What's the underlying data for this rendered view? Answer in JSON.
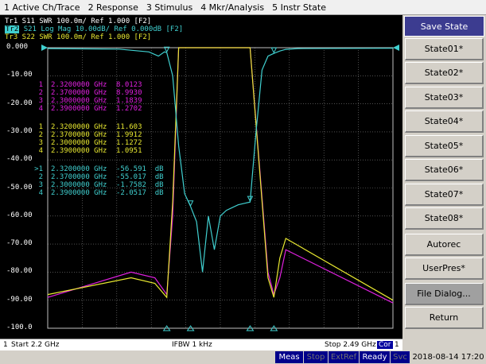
{
  "menu": [
    "1 Active Ch/Trace",
    "2 Response",
    "3 Stimulus",
    "4 Mkr/Analysis",
    "5 Instr State"
  ],
  "traces": {
    "tr1": "Tr1  S11  SWR 100.0m/ Ref 1.000 [F2]",
    "tr2_badge": "Tr2",
    "tr2": "S21 Log Mag 10.00dB/ Ref 0.000dB [F2]",
    "tr3": "Tr3  S22  SWR 100.0m/ Ref 1.000 [F2]"
  },
  "y_axis_labels": [
    "0.000",
    "-10.00",
    "-20.00",
    "-30.00",
    "-40.00",
    "-50.00",
    "-60.00",
    "-70.00",
    "-80.00",
    "-90.00",
    "-100.0"
  ],
  "marker_tables": {
    "s11": [
      {
        "n": "1",
        "freq": "2.3200000 GHz",
        "val": "8.0123"
      },
      {
        "n": "2",
        "freq": "2.3700000 GHz",
        "val": "8.9930"
      },
      {
        "n": "3",
        "freq": "2.3000000 GHz",
        "val": "1.1839"
      },
      {
        "n": "4",
        "freq": "2.3900000 GHz",
        "val": "1.2702"
      }
    ],
    "s22": [
      {
        "n": "1",
        "freq": "2.3200000 GHz",
        "val": "11.603"
      },
      {
        "n": "2",
        "freq": "2.3700000 GHz",
        "val": "1.9912"
      },
      {
        "n": "3",
        "freq": "2.3000000 GHz",
        "val": "1.1272"
      },
      {
        "n": "4",
        "freq": "2.3900000 GHz",
        "val": "1.0951"
      }
    ],
    "s21": [
      {
        "n": ">1",
        "freq": "2.3200000 GHz",
        "val": "-56.591  dB"
      },
      {
        "n": "2",
        "freq": "2.3700000 GHz",
        "val": "-55.017  dB"
      },
      {
        "n": "3",
        "freq": "2.3000000 GHz",
        "val": "-1.7582  dB"
      },
      {
        "n": "4",
        "freq": "2.3900000 GHz",
        "val": "-2.0517  dB"
      }
    ]
  },
  "softkeys": {
    "title": "Save State",
    "buttons": [
      "State01*",
      "State02*",
      "State03*",
      "State04*",
      "State05*",
      "State06*",
      "State07*",
      "State08*",
      "Autorec",
      "UserPres*",
      "File Dialog...",
      "Return"
    ]
  },
  "info": {
    "channel": "1",
    "start": "Start 2.2 GHz",
    "ifbw": "IFBW 1 kHz",
    "stop": "Stop 2.49 GHz",
    "cor": "Cor",
    "ch_right": "1"
  },
  "status": {
    "meas": "Meas",
    "stop": "Stop",
    "extref": "ExtRef",
    "ready": "Ready",
    "svc": "Svc",
    "datetime": "2018-08-14 17:20"
  },
  "colors": {
    "s11": "#e020e0",
    "s21": "#40d0d0",
    "s22": "#e8e830",
    "grid": "#808080",
    "softkey_title_bg": "#3c3c90"
  },
  "chart_data": {
    "type": "line",
    "x_range_ghz": [
      2.2,
      2.49
    ],
    "y_range_db": [
      -100,
      0
    ],
    "grid": true,
    "series": [
      {
        "name": "Tr2 S21 Log Mag",
        "x": [
          2.2,
          2.26,
          2.285,
          2.293,
          2.298,
          2.3,
          2.305,
          2.31,
          2.315,
          2.32,
          2.325,
          2.33,
          2.335,
          2.34,
          2.345,
          2.35,
          2.355,
          2.36,
          2.365,
          2.37,
          2.375,
          2.38,
          2.385,
          2.39,
          2.395,
          2.4,
          2.41,
          2.49
        ],
        "y": [
          -0.3,
          -0.5,
          -1.5,
          -3,
          -1.5,
          -1.76,
          -10,
          -35,
          -52,
          -56.6,
          -62,
          -80,
          -60,
          -72,
          -60,
          -58,
          -57,
          -56,
          -55.5,
          -55,
          -30,
          -8,
          -3,
          -2.05,
          -1.2,
          -0.6,
          -0.3,
          -0.2
        ]
      },
      {
        "name": "Tr1 S11 SWR",
        "x": [
          2.2,
          2.27,
          2.29,
          2.3,
          2.305,
          2.31,
          2.37,
          2.385,
          2.39,
          2.395,
          2.4,
          2.49
        ],
        "y": [
          -89,
          -80,
          -82,
          -88,
          -60,
          0,
          0,
          -80,
          -88,
          -82,
          -72,
          -91
        ]
      },
      {
        "name": "Tr3 S22 SWR",
        "x": [
          2.2,
          2.27,
          2.29,
          2.3,
          2.305,
          2.31,
          2.37,
          2.385,
          2.39,
          2.395,
          2.4,
          2.49
        ],
        "y": [
          -88,
          -82,
          -84,
          -89,
          -55,
          0,
          0,
          -82,
          -89,
          -75,
          -68,
          -90
        ]
      }
    ]
  }
}
